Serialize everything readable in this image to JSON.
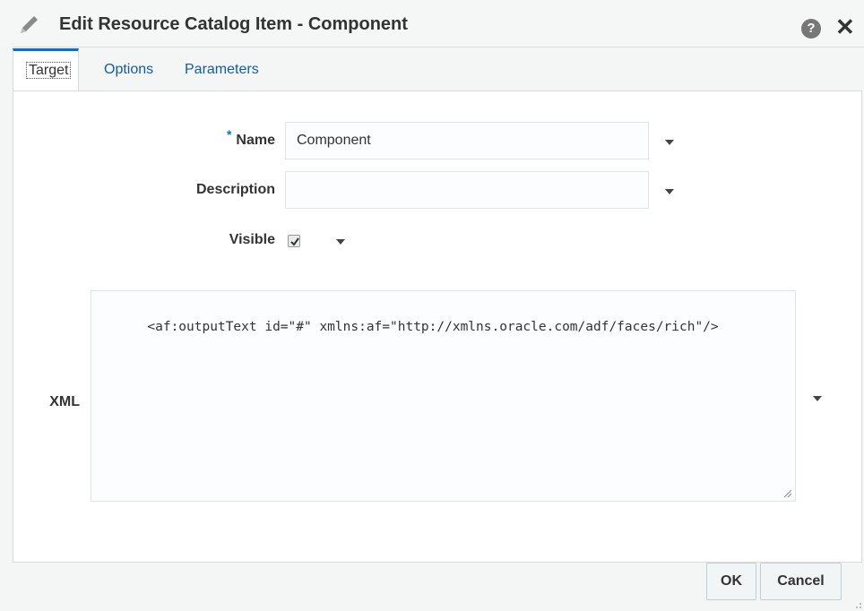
{
  "dialog": {
    "title": "Edit Resource Catalog Item - Component",
    "icon": "pencil-icon",
    "help_icon_glyph": "?",
    "close_icon_glyph": "✕"
  },
  "tabs": [
    {
      "label": "Target",
      "active": true
    },
    {
      "label": "Options",
      "active": false
    },
    {
      "label": "Parameters",
      "active": false
    }
  ],
  "form": {
    "name": {
      "required_marker": "*",
      "label": "Name",
      "value": "Component"
    },
    "description": {
      "label": "Description",
      "value": ""
    },
    "visible": {
      "label": "Visible",
      "checked": true
    },
    "xml": {
      "label": "XML",
      "value": "<af:outputText id=\"#\" xmlns:af=\"http://xmlns.oracle.com/adf/faces/rich\"/>"
    }
  },
  "buttons": {
    "ok_label": "OK",
    "cancel_label": "Cancel"
  },
  "colors": {
    "accent": "#0572ce",
    "link": "#145c9e",
    "background": "#f4f5f5"
  }
}
